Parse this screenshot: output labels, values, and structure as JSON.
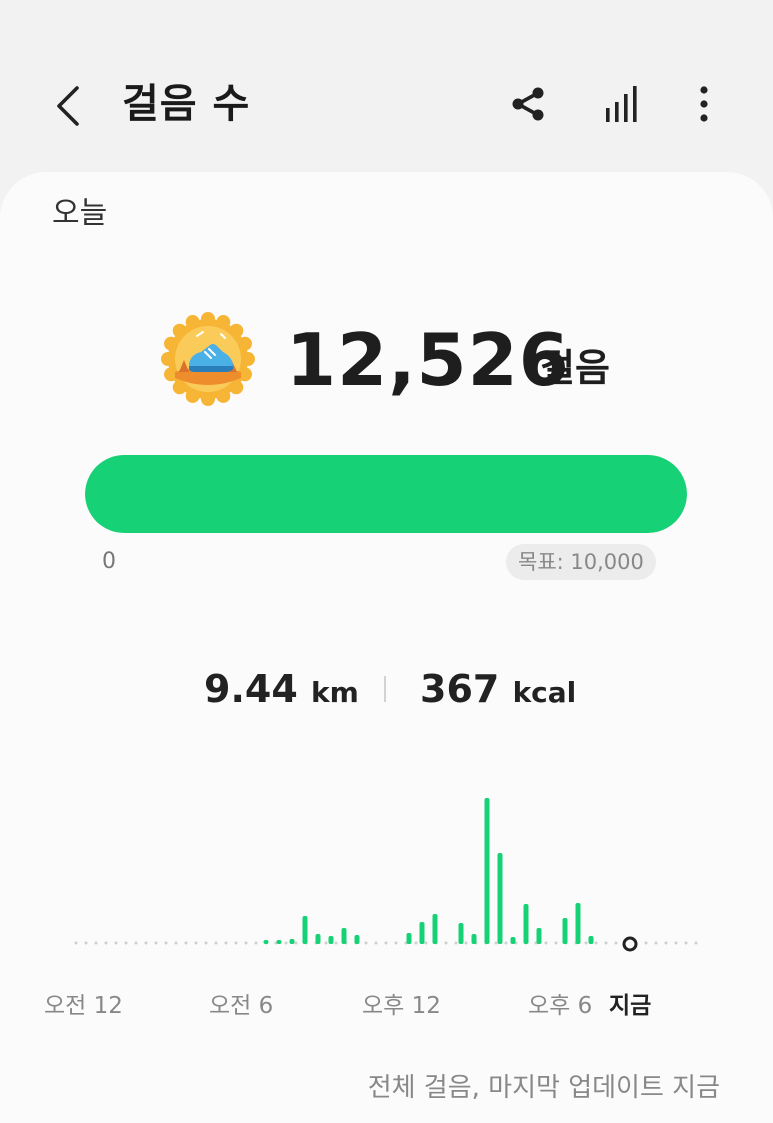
{
  "header": {
    "title": "걸음 수"
  },
  "icons": {
    "back": "chevron-left-icon",
    "share": "share-icon",
    "stats": "bar-chart-icon",
    "more": "more-vert-icon"
  },
  "card": {
    "period_label": "오늘",
    "steps_value": "12,526",
    "steps_unit": "걸음",
    "progress_fraction": 1.0,
    "progress_start_label": "0",
    "goal_label": "목표: 10,000",
    "distance_value": "9.44",
    "distance_unit": "km",
    "calories_value": "367",
    "calories_unit": "kcal",
    "footer_note": "전체 걸음, 마지막 업데이트 지금"
  },
  "colors": {
    "accent": "#16d175",
    "badge": "#f6b534",
    "text": "#1e1e1e",
    "muted": "#888888"
  },
  "chart_data": {
    "type": "bar",
    "x": [
      0.0,
      0.5,
      1.0,
      1.5,
      2.0,
      2.5,
      3.0,
      3.5,
      4.0,
      4.5,
      5.0,
      5.5,
      6.0,
      6.5,
      7.0,
      7.5,
      8.0,
      8.5,
      9.0,
      9.5,
      10.0,
      10.5,
      11.0,
      11.5,
      12.0,
      12.5,
      13.0,
      13.5,
      14.0,
      14.5,
      15.0,
      15.5,
      16.0,
      16.5,
      17.0,
      17.5,
      18.0,
      18.5,
      19.0,
      19.5,
      20.0,
      20.5,
      21.0,
      21.5,
      22.0,
      22.5,
      23.0,
      23.5
    ],
    "values": [
      0,
      0,
      0,
      0,
      0,
      0,
      0,
      0,
      0,
      0,
      0,
      0,
      0,
      0,
      4,
      4,
      5,
      28,
      10,
      8,
      16,
      9,
      0,
      0,
      0,
      11,
      22,
      30,
      0,
      21,
      10,
      146,
      91,
      7,
      40,
      16,
      0,
      26,
      41,
      8,
      0,
      0,
      0,
      0,
      0,
      0,
      0,
      0
    ],
    "xtick_labels": [
      "오전 12",
      "오전 6",
      "오후 12",
      "오후 6",
      "지금"
    ],
    "now_x": 20.5
  }
}
